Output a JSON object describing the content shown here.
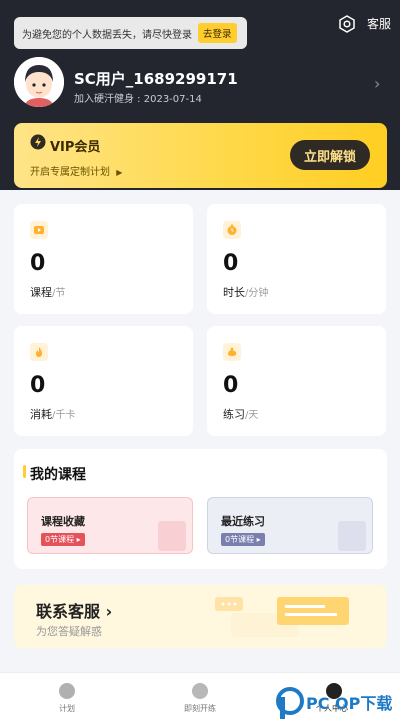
{
  "toast": {
    "text": "为避免您的个人数据丢失，请尽快登录",
    "login_label": "去登录"
  },
  "header": {
    "service_label": "客服"
  },
  "profile": {
    "username": "SC用户_1689299171",
    "join_text": "加入硬汗健身 : 2023-07-14"
  },
  "vip": {
    "title": "VIP会员",
    "subtitle": "开启专属定制计划",
    "button": "立即解锁"
  },
  "stats": [
    {
      "value": "0",
      "label": "课程",
      "unit": "/节",
      "icon": "video-icon"
    },
    {
      "value": "0",
      "label": "时长",
      "unit": "/分钟",
      "icon": "timer-icon"
    },
    {
      "value": "0",
      "label": "消耗",
      "unit": "/千卡",
      "icon": "flame-icon"
    },
    {
      "value": "0",
      "label": "练习",
      "unit": "/天",
      "icon": "muscle-icon"
    }
  ],
  "my_courses": {
    "title": "我的课程",
    "cards": [
      {
        "title": "课程收藏",
        "badge": "0节课程"
      },
      {
        "title": "最近练习",
        "badge": "0节课程"
      }
    ]
  },
  "contact": {
    "title": "联系客服",
    "subtitle": "为您答疑解惑"
  },
  "tabbar": {
    "items": [
      "计划",
      "即刻开练",
      "个人中心"
    ]
  },
  "watermark": {
    "text": "PC  OP下载"
  },
  "colors": {
    "accent": "#ffcd2e",
    "header_bg": "#23262e",
    "badge_red": "#e4525a",
    "badge_purple": "#7b7fb0"
  }
}
